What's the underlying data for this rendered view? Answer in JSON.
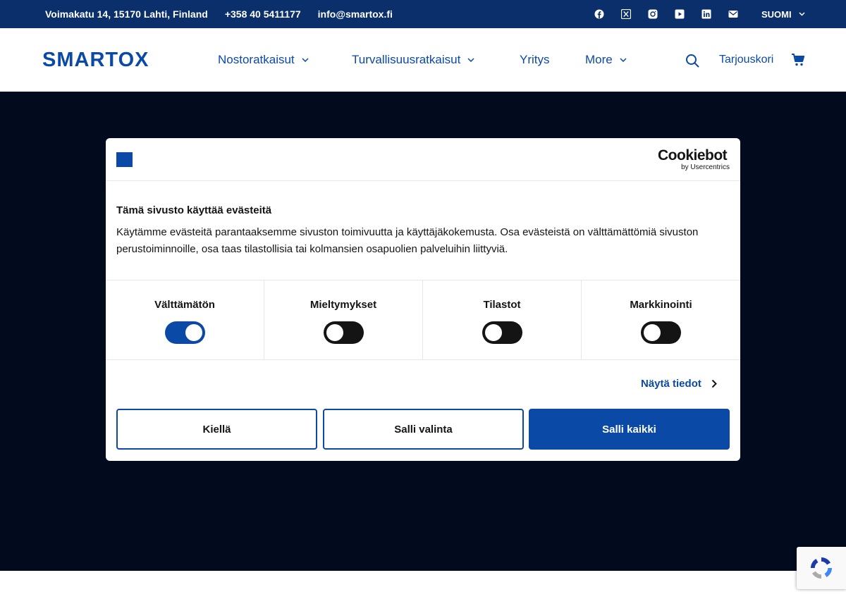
{
  "topbar": {
    "address": "Voimakatu 14, 15170 Lahti, Finland",
    "phone": "+358 40 5411177",
    "email": "info@smartox.fi",
    "social_icons": [
      "facebook-icon",
      "x-icon",
      "instagram-icon",
      "youtube-icon",
      "linkedin-icon",
      "mail-icon"
    ],
    "language": "SUOMI"
  },
  "header": {
    "logo": "SMARTOX",
    "nav": [
      {
        "label": "Nostoratkaisut",
        "has_dropdown": true
      },
      {
        "label": "Turvallisuusratkaisut",
        "has_dropdown": true
      },
      {
        "label": "Yritys",
        "has_dropdown": false
      },
      {
        "label": "More",
        "has_dropdown": true
      }
    ],
    "cart_label": "Tarjouskori"
  },
  "cookie_dialog": {
    "brand": "Cookiebot",
    "brand_sub": "by Usercentrics",
    "title": "Tämä sivusto käyttää evästeitä",
    "text": "Käytämme evästeitä parantaaksemme sivuston toimivuutta ja käyttäjäkokemusta. Osa evästeistä on välttämättömiä sivuston perustoiminnoille, osa taas tilastollisia tai kolmansien osapuolien palveluihin liittyviä.",
    "categories": [
      {
        "label": "Välttämätön",
        "enabled": true
      },
      {
        "label": "Mieltymykset",
        "enabled": false
      },
      {
        "label": "Tilastot",
        "enabled": false
      },
      {
        "label": "Markkinointi",
        "enabled": false
      }
    ],
    "details_link": "Näytä tiedot",
    "buttons": {
      "deny": "Kiellä",
      "allow_selection": "Salli valinta",
      "allow_all": "Salli kaikki"
    }
  },
  "colors": {
    "topbar_bg": "#0a2f6b",
    "brand_blue": "#0b49a6",
    "overlay": "#020b1d",
    "text_dark": "#141414"
  }
}
